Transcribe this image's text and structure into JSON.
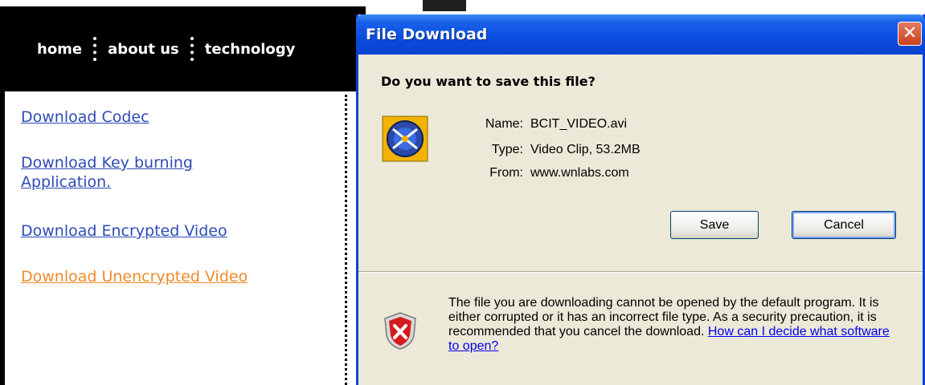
{
  "page": {
    "nav": [
      "home",
      "about us",
      "technology"
    ],
    "links": [
      {
        "label": "Download Codec",
        "visited": false
      },
      {
        "label": "Download Key burning Application.",
        "visited": false
      },
      {
        "label": "Download Encrypted Video",
        "visited": false
      },
      {
        "label": "Download Unencrypted Video",
        "visited": true
      }
    ],
    "colors": {
      "link": "#2d4bb8",
      "visited_link": "#f08a2a",
      "nav_bg": "#000000"
    }
  },
  "dialog": {
    "title": "File Download",
    "close_symbol": "✕",
    "question": "Do you want to save this file?",
    "file_icon": "video-file-icon",
    "fields": {
      "name_label": "Name:",
      "name_value": "BCIT_VIDEO.avi",
      "type_label": "Type:",
      "type_value": "Video Clip, 53.2MB",
      "from_label": "From:",
      "from_value": "www.wnlabs.com"
    },
    "buttons": {
      "save": "Save",
      "cancel": "Cancel"
    },
    "warning": {
      "icon": "security-shield-icon",
      "text": "The file you are downloading cannot be opened by the default program. It is either corrupted or it has an incorrect file type. As a security precaution, it is recommended that you cancel the download.",
      "link": "How can I decide what software to open?"
    },
    "colors": {
      "titlebar": "#0b4fe0",
      "body": "#ece9d8",
      "close": "#c8401c"
    }
  }
}
